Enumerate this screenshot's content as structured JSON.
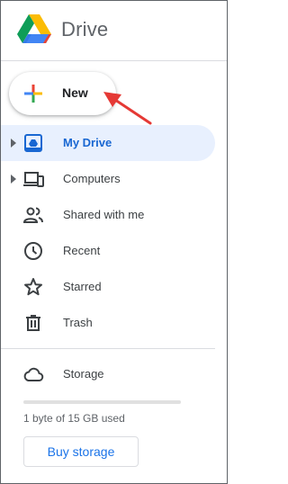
{
  "app": {
    "title": "Drive",
    "logo_icon": "google-drive-logo-icon"
  },
  "new_button": {
    "label": "New",
    "icon": "plus-icon"
  },
  "annotation": {
    "color": "#e53935",
    "icon": "red-arrow-icon"
  },
  "nav": {
    "items": [
      {
        "label": "My Drive",
        "icon": "my-drive-icon",
        "expandable": true,
        "active": true
      },
      {
        "label": "Computers",
        "icon": "computers-icon",
        "expandable": true,
        "active": false
      },
      {
        "label": "Shared with me",
        "icon": "shared-with-me-icon",
        "expandable": false,
        "active": false
      },
      {
        "label": "Recent",
        "icon": "clock-icon",
        "expandable": false,
        "active": false
      },
      {
        "label": "Starred",
        "icon": "star-icon",
        "expandable": false,
        "active": false
      },
      {
        "label": "Trash",
        "icon": "trash-icon",
        "expandable": false,
        "active": false
      }
    ]
  },
  "storage": {
    "label": "Storage",
    "icon": "cloud-icon",
    "used_fraction": 0.0,
    "usage_text": "1 byte of 15 GB used",
    "buy_label": "Buy storage"
  },
  "colors": {
    "accent": "#1a73e8",
    "active_bg": "#e8f0fe",
    "active_text": "#1967d2"
  }
}
